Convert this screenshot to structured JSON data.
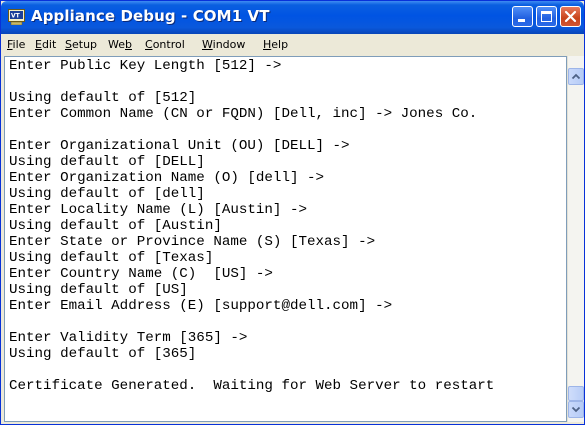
{
  "window": {
    "title": "Appliance Debug - COM1 VT",
    "icon": "terminal-app-icon",
    "controls": [
      "minimize-icon",
      "maximize-icon",
      "close-icon"
    ]
  },
  "menu": {
    "items": [
      {
        "label": "File",
        "underline": "F",
        "rest": "ile"
      },
      {
        "label": "Edit",
        "underline": "E",
        "rest": "dit"
      },
      {
        "label": "Setup",
        "underline": "S",
        "rest": "etup"
      },
      {
        "label": "Web",
        "pre": "We",
        "underline": "b",
        "rest": ""
      },
      {
        "label": "Control",
        "underline": "C",
        "rest": "ontrol"
      },
      {
        "label": "Window",
        "underline": "W",
        "rest": "indow"
      },
      {
        "label": "Help",
        "underline": "H",
        "rest": "elp"
      }
    ]
  },
  "terminal": {
    "lines": [
      "Enter Public Key Length [512] ->",
      "",
      "Using default of [512]",
      "Enter Common Name (CN or FQDN) [Dell, inc] -> Jones Co.",
      "",
      "Enter Organizational Unit (OU) [DELL] ->",
      "Using default of [DELL]",
      "Enter Organization Name (O) [dell] ->",
      "Using default of [dell]",
      "Enter Locality Name (L) [Austin] ->",
      "Using default of [Austin]",
      "Enter State or Province Name (S) [Texas] ->",
      "Using default of [Texas]",
      "Enter Country Name (C)  [US] ->",
      "Using default of [US]",
      "Enter Email Address (E) [support@dell.com] ->",
      "",
      "Enter Validity Term [365] ->",
      "Using default of [365]",
      "",
      "Certificate Generated.  Waiting for Web Server to restart"
    ]
  },
  "scrollbar": {
    "up_icon": "scroll-up-arrow-icon",
    "down_icon": "scroll-down-arrow-icon"
  }
}
